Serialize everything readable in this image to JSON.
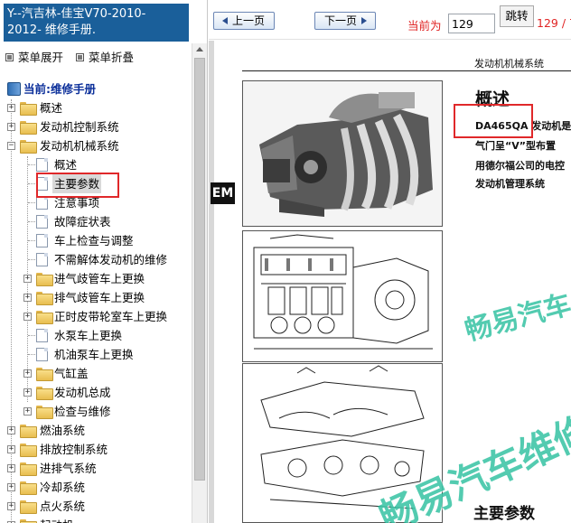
{
  "sidebar": {
    "title_line1": "Y--汽吉林-佳宝V70-2010-",
    "title_line2": "2012- 维修手册.",
    "expand_label": "菜单展开",
    "collapse_label": "菜单折叠",
    "current_label": "当前:维修手册",
    "items": [
      {
        "label": "概述"
      },
      {
        "label": "发动机控制系统"
      },
      {
        "label": "发动机机械系统"
      },
      {
        "label": "概述"
      },
      {
        "label": "主要参数"
      },
      {
        "label": "注意事项"
      },
      {
        "label": "故障症状表"
      },
      {
        "label": "车上检查与调整"
      },
      {
        "label": "不需解体发动机的维修"
      },
      {
        "label": "进气歧管车上更换"
      },
      {
        "label": "排气歧管车上更换"
      },
      {
        "label": "正时皮带轮室车上更换"
      },
      {
        "label": "水泵车上更换"
      },
      {
        "label": "机油泵车上更换"
      },
      {
        "label": "气缸盖"
      },
      {
        "label": "发动机总成"
      },
      {
        "label": "检查与维修"
      },
      {
        "label": "燃油系统"
      },
      {
        "label": "排放控制系统"
      },
      {
        "label": "进排气系统"
      },
      {
        "label": "冷却系统"
      },
      {
        "label": "点火系统"
      },
      {
        "label": "起动机"
      }
    ]
  },
  "toolbar": {
    "prev_label": "上一页",
    "next_label": "下一页",
    "current_page_label": "当前为",
    "page_value": "129",
    "goto_label": "跳转",
    "total_label": "129 / 7"
  },
  "document": {
    "header": "发动机机械系统",
    "tab_label": "EM",
    "heading": "概述",
    "para_line1": "DA465QA 发动机是",
    "para_line2": "气门呈“V”型布置",
    "para_line3": "用德尔福公司的电控",
    "para_line4": "发动机管理系统",
    "section_heading": "主要参数",
    "watermark_small": "畅易汽车",
    "watermark_large": "畅易汽车维修"
  }
}
